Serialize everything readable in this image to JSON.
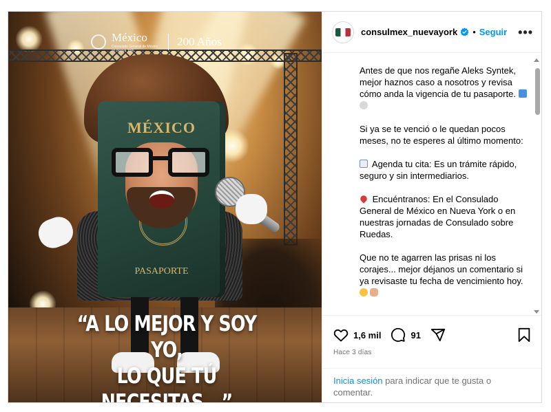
{
  "post": {
    "image": {
      "logo_text": "México",
      "logo_subtext": "Consulado General de México en Nueva York",
      "logo_year": "200 Años",
      "passport_title": "MÉXICO",
      "passport_subtitle": "PASAPORTE",
      "quote_line1": "“A LO MEJOR Y SOY YO,",
      "quote_line2": "LO QUE TÚ NECESITAS...”"
    },
    "header": {
      "username": "consulmex_nuevayork",
      "separator": "•",
      "follow_label": "Seguir",
      "more_label": "•••",
      "verified": true
    },
    "caption": {
      "p1": "Antes de que nos regañe Aleks Syntek, mejor haznos caso a nosotros y revisa cómo anda la vigencia de tu pasaporte.",
      "p2": "Si ya se te venció o le quedan pocos meses, no te esperes al último momento:",
      "p3": "Agenda tu cita: Es un trámite rápido, seguro y sin intermediarios.",
      "p4": "Encuéntranos: En el Consulado General de México en Nueva York o en nuestras jornadas de Consulado sobre Ruedas.",
      "p5": "Que no te agarren las prisas ni los corajes... mejor déjanos un comentario si ya revisaste tu fecha de vencimiento hoy."
    },
    "stats": {
      "likes": "1,6 mil",
      "comments": "91"
    },
    "date": "Hace 3 días",
    "login": {
      "link": "Inicia sesión",
      "rest": " para indicar que te gusta o comentar."
    }
  },
  "colors": {
    "accent": "#0095f6",
    "muted": "#737373",
    "border": "#dbdbdb",
    "passport_green": "#24443a",
    "passport_gold": "#d7b56a"
  },
  "icons": [
    "verified-badge-icon",
    "more-icon",
    "heart-icon",
    "comment-icon",
    "share-icon",
    "bookmark-icon",
    "passport-emoji-icon",
    "eyes-emoji-icon",
    "calendar-emoji-icon",
    "pin-emoji-icon",
    "laugh-emoji-icon",
    "point-down-emoji-icon"
  ]
}
